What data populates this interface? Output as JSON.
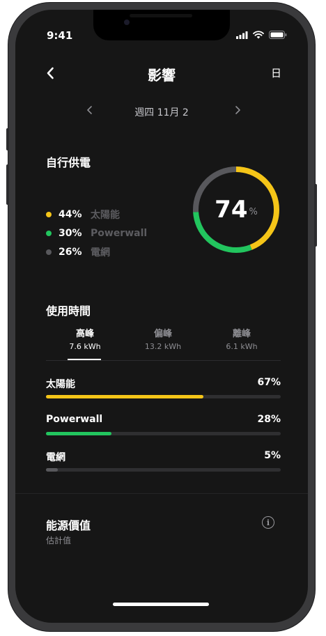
{
  "status_bar": {
    "time": "9:41"
  },
  "header": {
    "title": "影響",
    "day_label": "日"
  },
  "date_nav": {
    "label": "週四 11月 2"
  },
  "self_powered": {
    "title": "自行供電",
    "percent_value": "74",
    "percent_unit": "%",
    "sources": [
      {
        "pct": "44%",
        "label": "太陽能",
        "color": "#f5c518",
        "share": 0.44
      },
      {
        "pct": "30%",
        "label": "Powerwall",
        "color": "#22c55e",
        "share": 0.3
      },
      {
        "pct": "26%",
        "label": "電網",
        "color": "#58585c",
        "share": 0.26
      }
    ]
  },
  "usage_time": {
    "title": "使用時間",
    "tabs": [
      {
        "name": "高峰",
        "value": "7.6 kWh",
        "active": true
      },
      {
        "name": "偏峰",
        "value": "13.2 kWh",
        "active": false
      },
      {
        "name": "離峰",
        "value": "6.1 kWh",
        "active": false
      }
    ],
    "bars": [
      {
        "label": "太陽能",
        "pct": "67%",
        "fraction": 0.67,
        "color": "#f5c518"
      },
      {
        "label": "Powerwall",
        "pct": "28%",
        "fraction": 0.28,
        "color": "#22c55e"
      },
      {
        "label": "電網",
        "pct": "5%",
        "fraction": 0.05,
        "color": "#58585c"
      }
    ]
  },
  "energy_value": {
    "title": "能源價值",
    "subtitle": "估計值",
    "info_icon": "info-icon"
  }
}
